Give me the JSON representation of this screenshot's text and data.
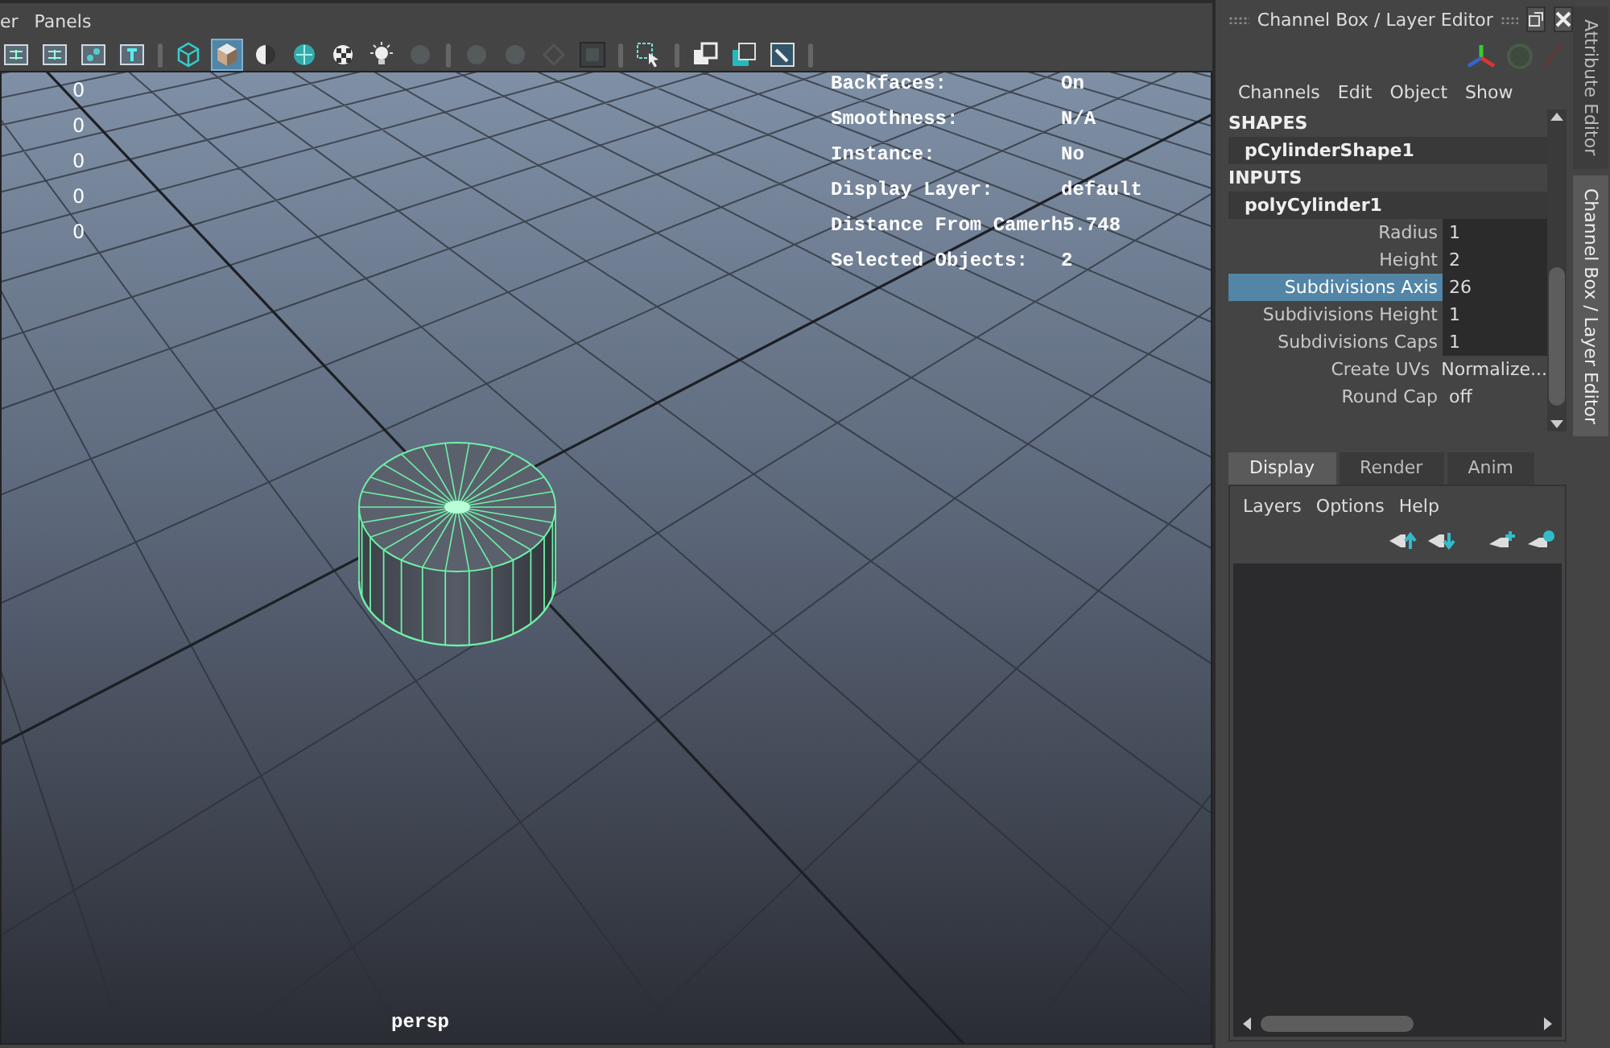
{
  "menu_bar": [
    "er",
    "Panels"
  ],
  "toolbar": [
    {
      "kind": "panel",
      "selected": false
    },
    {
      "kind": "panel",
      "selected": false
    },
    {
      "kind": "dots",
      "selected": false
    },
    {
      "kind": "text-frame",
      "selected": false
    },
    {
      "kind": "sep"
    },
    {
      "kind": "wire-cube",
      "selected": false
    },
    {
      "kind": "shaded-cube",
      "selected": true
    },
    {
      "kind": "half",
      "selected": false
    },
    {
      "kind": "sphere",
      "selected": false
    },
    {
      "kind": "checker",
      "selected": false
    },
    {
      "kind": "light",
      "selected": false
    },
    {
      "kind": "dim",
      "selected": false
    },
    {
      "kind": "sep"
    },
    {
      "kind": "dim",
      "selected": false
    },
    {
      "kind": "dim",
      "selected": false
    },
    {
      "kind": "dim-ring",
      "selected": false
    },
    {
      "kind": "dark-box",
      "selected": false
    },
    {
      "kind": "sep"
    },
    {
      "kind": "select",
      "selected": false
    },
    {
      "kind": "sep"
    },
    {
      "kind": "windows",
      "selected": false
    },
    {
      "kind": "window-teal",
      "selected": false
    },
    {
      "kind": "image",
      "selected": false
    },
    {
      "kind": "sep"
    }
  ],
  "viewport": {
    "counts": [
      "0",
      "0",
      "0",
      "0",
      "0"
    ],
    "hud": [
      {
        "label": "Backfaces:",
        "value": "On"
      },
      {
        "label": "Smoothness:",
        "value": "N/A"
      },
      {
        "label": "Instance:",
        "value": "No"
      },
      {
        "label": "Display Layer:",
        "value": "default"
      },
      {
        "label": "Distance From Camerh5.748"
      },
      {
        "label": "Selected Objects:",
        "value": "2"
      }
    ],
    "camera": "persp"
  },
  "channel_box": {
    "title": "Channel Box / Layer Editor",
    "menu": [
      "Channels",
      "Edit",
      "Object",
      "Show"
    ],
    "sections": [
      {
        "heading": "SHAPES",
        "node": "pCylinderShape1"
      },
      {
        "heading": "INPUTS",
        "node": "polyCylinder1",
        "attributes": [
          {
            "name": "Radius",
            "value": "1",
            "kind": "field",
            "selected": false
          },
          {
            "name": "Height",
            "value": "2",
            "kind": "field",
            "selected": false
          },
          {
            "name": "Subdivisions Axis",
            "value": "26",
            "kind": "field",
            "selected": true
          },
          {
            "name": "Subdivisions Height",
            "value": "1",
            "kind": "field",
            "selected": false
          },
          {
            "name": "Subdivisions Caps",
            "value": "1",
            "kind": "field",
            "selected": false
          },
          {
            "name": "Create UVs",
            "value": "Normalize...",
            "kind": "option",
            "selected": false
          },
          {
            "name": "Round Cap",
            "value": "off",
            "kind": "option",
            "selected": false
          }
        ]
      }
    ]
  },
  "side_tabs": [
    {
      "label": "Attribute Editor",
      "selected": false
    },
    {
      "label": "Channel Box / Layer Editor",
      "selected": true
    }
  ],
  "layer_editor": {
    "tabs": [
      {
        "label": "Display",
        "selected": true
      },
      {
        "label": "Render",
        "selected": false
      },
      {
        "label": "Anim",
        "selected": false
      }
    ],
    "menu": [
      "Layers",
      "Options",
      "Help"
    ]
  }
}
